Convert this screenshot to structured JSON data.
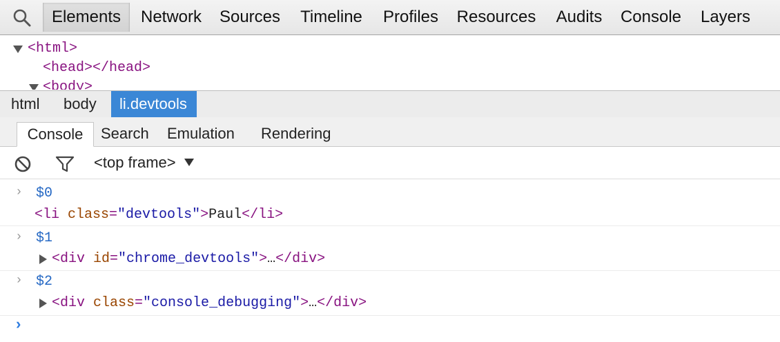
{
  "tabs": [
    "Elements",
    "Network",
    "Sources",
    "Timeline",
    "Profiles",
    "Resources",
    "Audits",
    "Console",
    "Layers"
  ],
  "active_tab": "Elements",
  "dom_tree": [
    "<html>",
    "<head></head>",
    "<body>"
  ],
  "breadcrumb": [
    "html",
    "body",
    "li.devtools"
  ],
  "drawer_tabs": [
    "Console",
    "Search",
    "Emulation",
    "Rendering"
  ],
  "frame_selector": "<top frame>",
  "console": {
    "entries": [
      {
        "command": "$0",
        "result": {
          "open": "<li ",
          "attr": "class",
          "eq": "=",
          "val": "\"devtools\"",
          "close": ">",
          "text": "Paul",
          "end": "</li>"
        }
      },
      {
        "command": "$1",
        "result": {
          "open": "<div ",
          "attr": "id",
          "eq": "=",
          "val": "\"chrome_devtools\"",
          "close": ">",
          "text": "…",
          "end": "</div>"
        }
      },
      {
        "command": "$2",
        "result": {
          "open": "<div ",
          "attr": "class",
          "eq": "=",
          "val": "\"console_debugging\"",
          "close": ">",
          "text": "…",
          "end": "</div>"
        }
      }
    ],
    "prompt_glyph": ">",
    "input_glyph": "›"
  },
  "colors": {
    "tag": "#881280",
    "attr_name": "#994500",
    "attr_value": "#1a1aa6",
    "command": "#2568c4",
    "selected_crumb": "#3b87d6"
  },
  "icons": [
    "search-icon",
    "clear-console-icon",
    "filter-icon",
    "dropdown-arrow-icon",
    "expand-triangle-icon"
  ]
}
